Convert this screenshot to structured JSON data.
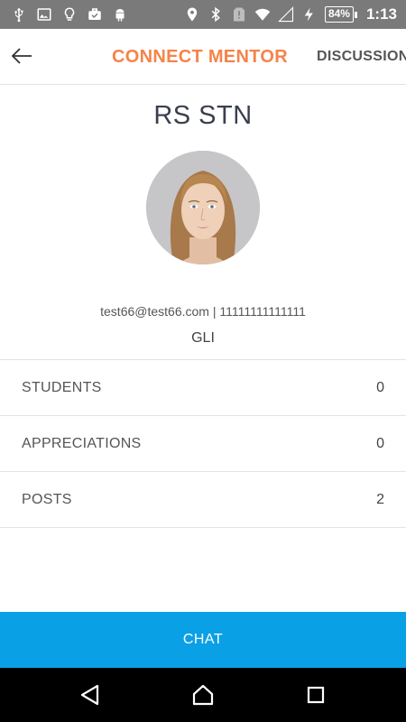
{
  "status_bar": {
    "left_icons": [
      "usb-icon",
      "image-icon",
      "lightbulb-icon",
      "briefcase-check-icon",
      "android-icon"
    ],
    "right_icons": [
      "location-icon",
      "bluetooth-icon",
      "alert-icon",
      "wifi-icon",
      "signal-icon",
      "charging-icon"
    ],
    "battery": "84%",
    "time": "1:13"
  },
  "app_bar": {
    "back_icon": "arrow-left-icon",
    "active_tab": "CONNECT MENTOR",
    "next_tab": "DISCUSSION",
    "accent_color": "#f4844a"
  },
  "profile": {
    "name": "RS STN",
    "contact": "test66@test66.com | 11111111111111",
    "organization": "GLI"
  },
  "stats": [
    {
      "label": "STUDENTS",
      "value": "0"
    },
    {
      "label": "APPRECIATIONS",
      "value": "0"
    },
    {
      "label": "POSTS",
      "value": "2"
    }
  ],
  "chat_button": {
    "label": "CHAT",
    "color": "#0aa0e6"
  },
  "nav_bar": {
    "icons": [
      "back-triangle-icon",
      "home-icon",
      "recents-icon"
    ]
  }
}
